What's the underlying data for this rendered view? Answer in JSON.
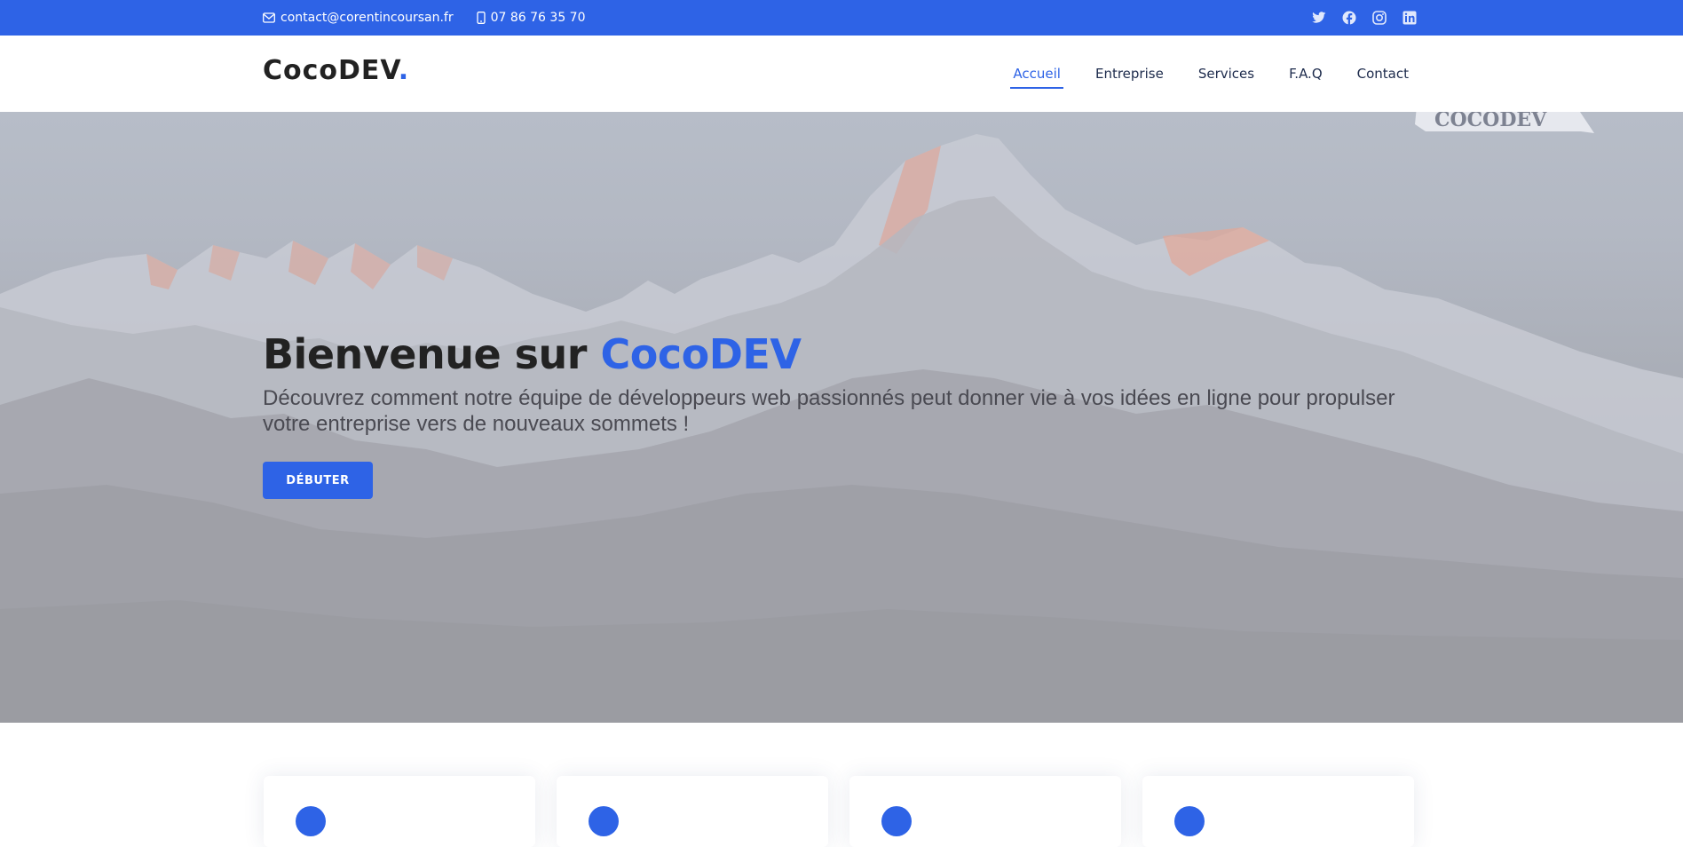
{
  "topbar": {
    "email": "contact@corentincoursan.fr",
    "phone": "07 86 76 35 70",
    "social": [
      "twitter-icon",
      "facebook-icon",
      "instagram-icon",
      "linkedin-icon"
    ]
  },
  "header": {
    "logo_text": "CocoDEV",
    "logo_dot": ".",
    "nav": [
      {
        "label": "Accueil",
        "active": true
      },
      {
        "label": "Entreprise",
        "active": false
      },
      {
        "label": "Services",
        "active": false
      },
      {
        "label": "F.A.Q",
        "active": false
      },
      {
        "label": "Contact",
        "active": false
      }
    ]
  },
  "hero": {
    "title_prefix": "Bienvenue sur ",
    "title_brand": "CocoDEV",
    "subtitle": "Découvrez comment notre équipe de développeurs web passionnés peut donner vie à vos idées en ligne pour propulser votre entreprise vers de nouveaux sommets !",
    "cta_label": "DÉBUTER",
    "flag_text": "COCODEV"
  },
  "colors": {
    "accent": "#2e63e6",
    "topbar": "#2e63e6",
    "text_dark": "#222222",
    "nav_text": "#1d2b4c"
  }
}
